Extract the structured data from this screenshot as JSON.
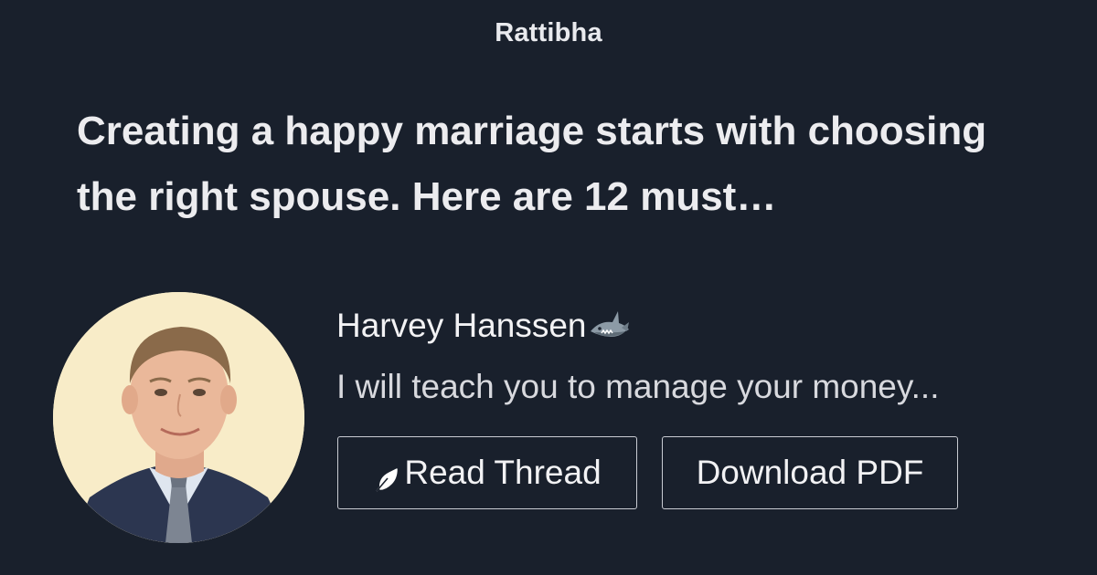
{
  "brand": "Rattibha",
  "thread": {
    "title": "Creating a happy marriage starts with choosing the right spouse. Here are 12 must…"
  },
  "author": {
    "name": "Harvey Hanssen",
    "name_emoji_icon": "shark-icon",
    "bio": "I will teach you to manage your money..."
  },
  "buttons": {
    "read_thread": "Read Thread",
    "read_thread_icon": "feather-icon",
    "download_pdf": "Download PDF"
  },
  "colors": {
    "background": "#19202c",
    "text": "#ececef",
    "button_border": "#c9ccd3",
    "avatar_background": "#f8ecc8"
  }
}
